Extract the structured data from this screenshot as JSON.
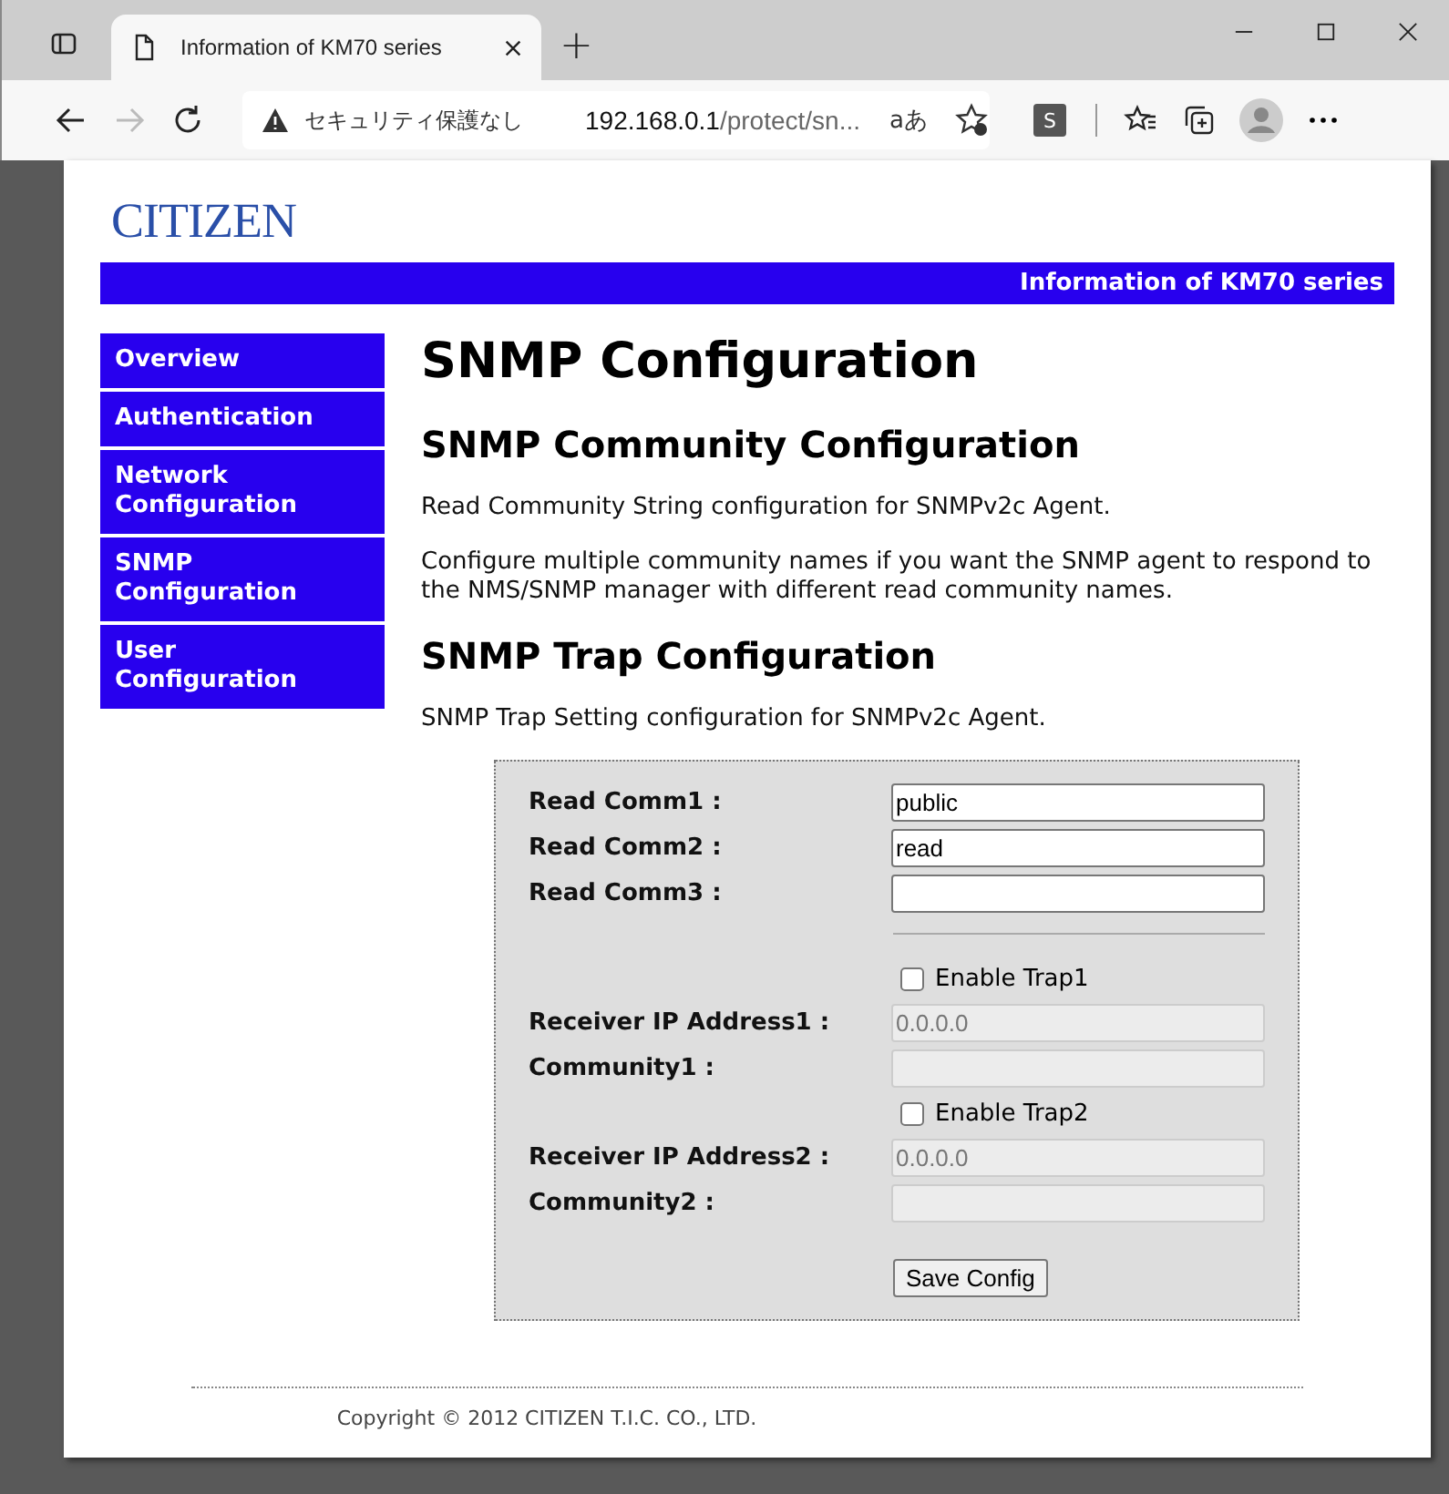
{
  "browser": {
    "tab_title": "Information of KM70 series",
    "new_tab": "+",
    "security": "セキュリティ保護なし",
    "url_host": "192.168.0.1",
    "url_path": "/protect/sn...",
    "read_aloud": "aあ",
    "ext_letter": "S"
  },
  "header": {
    "logo": "CITIZEN",
    "banner": "Information of KM70 series"
  },
  "sidebar": {
    "items": [
      {
        "label": "Overview"
      },
      {
        "label": "Authentication"
      },
      {
        "label": "Network Configuration"
      },
      {
        "label": "SNMP Configuration"
      },
      {
        "label": "User Configuration"
      }
    ]
  },
  "title": "SNMP Configuration",
  "sections": [
    {
      "heading": "SNMP Community Configuration",
      "paragraphs": [
        "Read Community String configuration for SNMPv2c Agent.",
        "Configure multiple community names if you want the SNMP agent to respond to the NMS/SNMP manager with different read community names."
      ]
    },
    {
      "heading": "SNMP Trap Configuration",
      "paragraphs": [
        "SNMP Trap Setting configuration for SNMPv2c Agent."
      ]
    }
  ],
  "form": {
    "rows": [
      {
        "kind": "field",
        "label": "Read Comm1 :",
        "value": "public",
        "disabled": false
      },
      {
        "kind": "field",
        "label": "Read Comm2 :",
        "value": "read",
        "disabled": false
      },
      {
        "kind": "field",
        "label": "Read Comm3 :",
        "disabled": false
      },
      {
        "kind": "rule"
      },
      {
        "kind": "checkbox",
        "label": "Enable Trap1",
        "checked": false
      },
      {
        "kind": "field",
        "label": "Receiver IP Address1 :",
        "value": "0.0.0.0",
        "disabled": true
      },
      {
        "kind": "field",
        "label": "Community1 :",
        "disabled": true
      },
      {
        "kind": "checkbox",
        "label": "Enable Trap2",
        "checked": false
      },
      {
        "kind": "field",
        "label": "Receiver IP Address2 :",
        "value": "0.0.0.0",
        "disabled": true
      },
      {
        "kind": "field",
        "label": "Community2 :",
        "disabled": true
      }
    ],
    "button": "Save Config"
  },
  "footer": "Copyright © 2012 CITIZEN T.I.C. CO., LTD."
}
